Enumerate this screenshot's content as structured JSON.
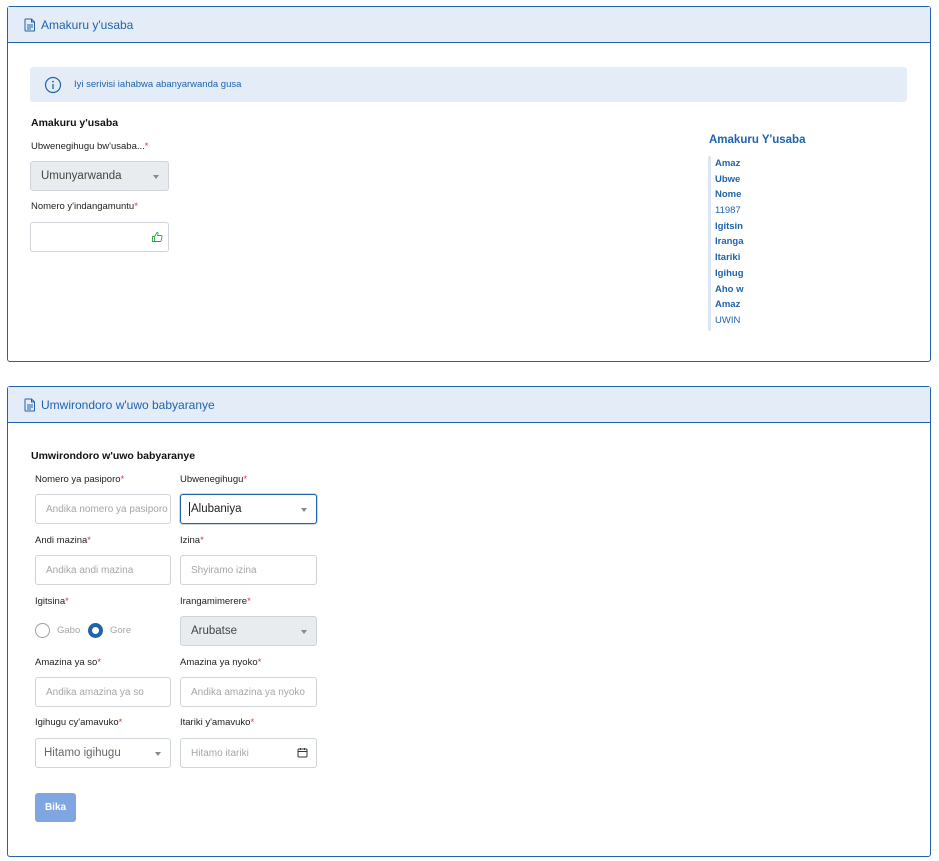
{
  "section1": {
    "header_title": "Amakuru y'usaba",
    "info_text": "Iyi serivisi iahabwa abanyarwanda gusa",
    "form_title": "Amakuru y'usaba",
    "nationality_label": "Ubwenegihugu bw'usaba...",
    "nationality_value": "Umunyarwanda",
    "id_label": "Nomero y'indangamuntu",
    "id_value": ""
  },
  "side_panel": {
    "title": "Amakuru Y'usaba",
    "items": [
      {
        "text": "Amaz",
        "bold": true
      },
      {
        "text": "Ubwe",
        "bold": true
      },
      {
        "text": "Nome",
        "bold": true
      },
      {
        "text": "11987",
        "bold": false
      },
      {
        "text": "Igitsin",
        "bold": true
      },
      {
        "text": "Iranga",
        "bold": true
      },
      {
        "text": "Itariki",
        "bold": true
      },
      {
        "text": "Igihug",
        "bold": true
      },
      {
        "text": "Aho w",
        "bold": true
      },
      {
        "text": "Amaz",
        "bold": true
      },
      {
        "text": "UWIN",
        "bold": false
      }
    ]
  },
  "section2": {
    "header_title": "Umwirondoro w'uwo babyaranye",
    "form_title": "Umwirondoro w'uwo babyaranye",
    "passport_label": "Nomero ya pasiporo",
    "passport_placeholder": "Andika nomero ya pasiporo",
    "nationality_label": "Ubwenegihugu",
    "nationality_value": "Alubaniya",
    "surname_label": "Andi mazina",
    "surname_placeholder": "Andika andi mazina",
    "firstname_label": "Izina",
    "firstname_placeholder": "Shyiramo izina",
    "gender_label": "Igitsina",
    "gender_options": [
      "Gabo",
      "Gore"
    ],
    "gender_selected": "Gore",
    "identity_label": "Irangamimerere",
    "identity_value": "Arubatse",
    "father_label": "Amazina ya so",
    "father_placeholder": "Andika amazina ya so",
    "mother_label": "Amazina ya nyoko",
    "mother_placeholder": "Andika amazina ya nyoko",
    "birth_country_label": "Igihugu cy'amavuko",
    "birth_country_placeholder": "Hitamo igihugu",
    "birth_date_label": "Itariki y'amavuko",
    "birth_date_placeholder": "Hitamo itariki",
    "submit_label": "Bika"
  },
  "required_mark": "*",
  "colors": {
    "primary": "#1f63ad",
    "header_bg": "#e4edf7",
    "required": "#dc3545",
    "submit_bg": "#7fa6e0"
  }
}
